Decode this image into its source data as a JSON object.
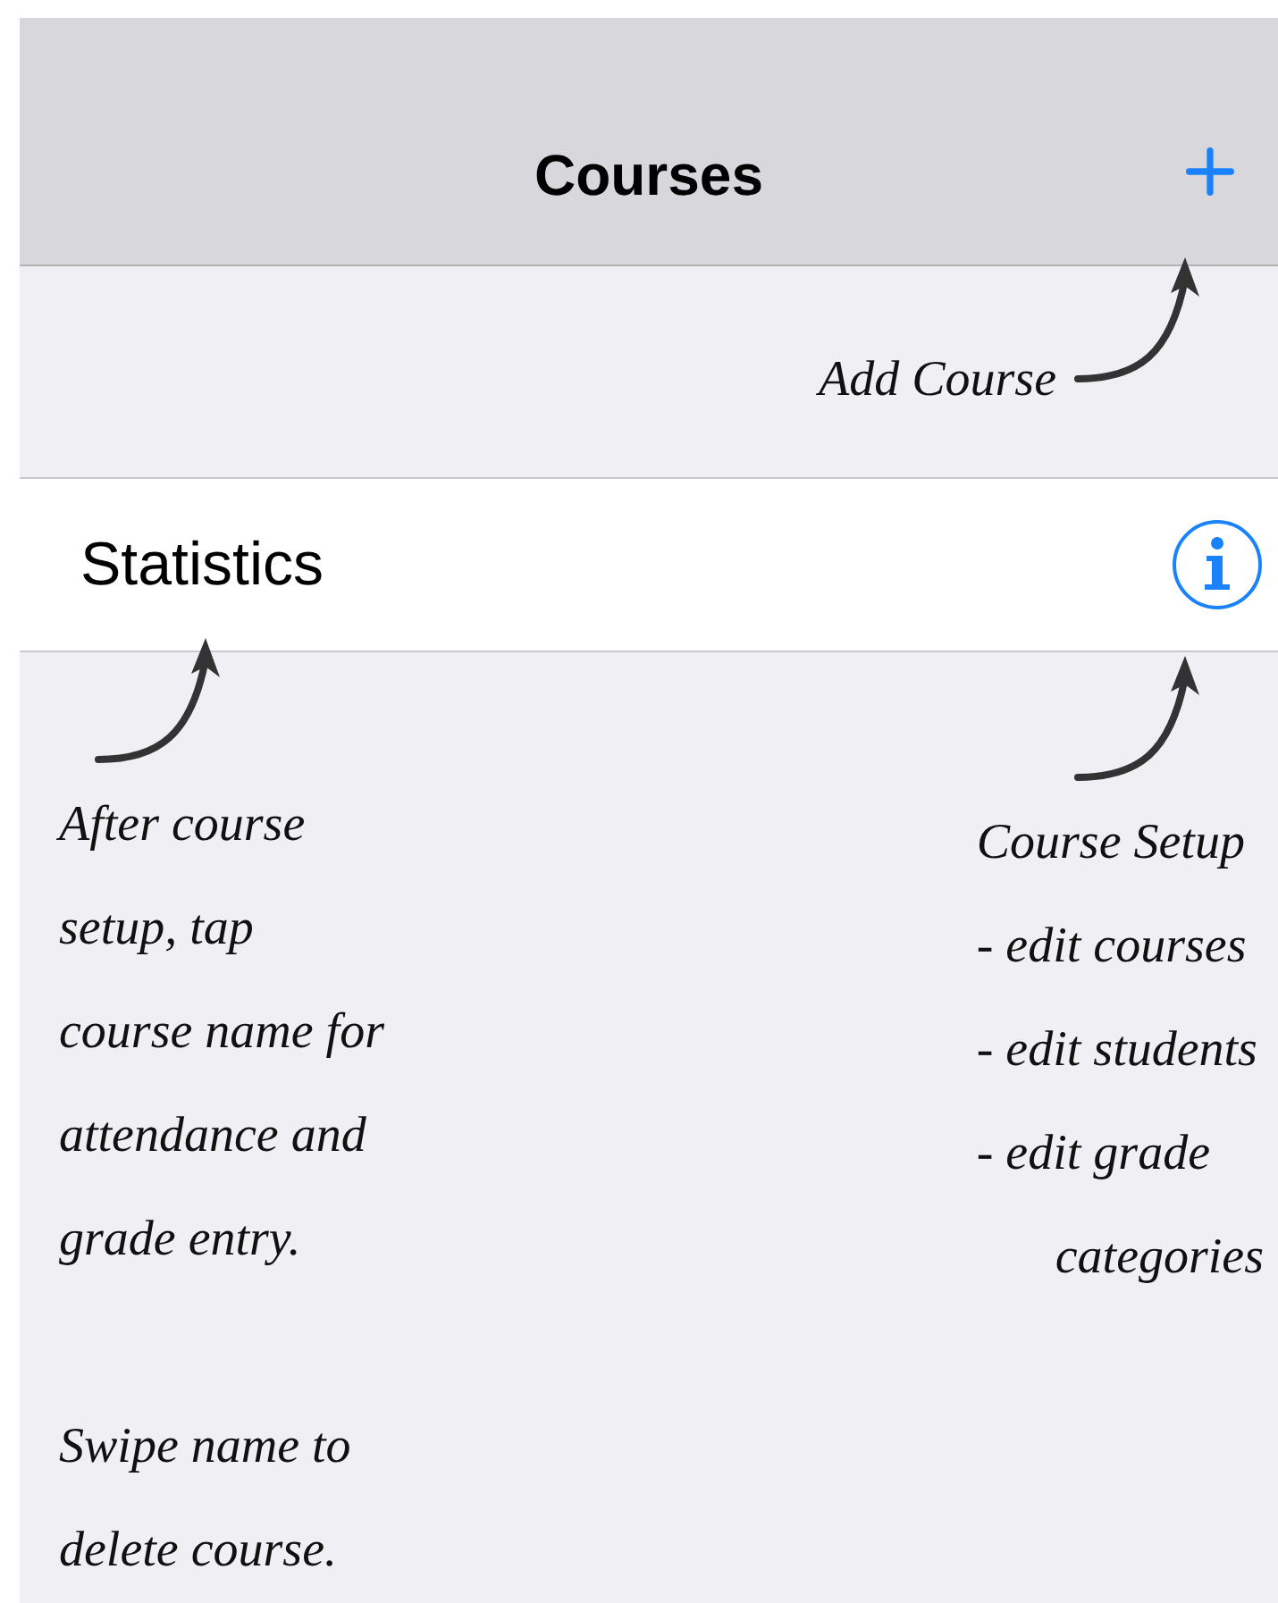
{
  "nav_bar": {
    "title": "Courses"
  },
  "rows": [
    {
      "label": "Statistics"
    }
  ],
  "annotations": [
    {
      "kind": "top",
      "paragraphs": [
        [
          "Add Course"
        ]
      ]
    },
    {
      "kind": "left",
      "paragraphs": [
        [
          "After course",
          "setup, tap",
          "course name for",
          "attendance and",
          "grade entry."
        ],
        [
          "Swipe name to",
          "delete course."
        ]
      ]
    },
    {
      "kind": "right",
      "paragraphs": [
        [
          "Course Setup",
          "- edit courses",
          "- edit students",
          "- edit grade",
          "categories"
        ]
      ]
    }
  ]
}
